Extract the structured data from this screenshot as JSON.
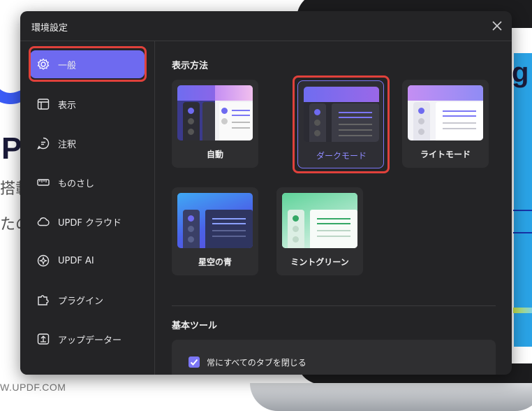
{
  "background": {
    "big_letter": "P",
    "text_line1": "搭載",
    "text_line2": "たの",
    "url": "W.UPDF.COM"
  },
  "dialog": {
    "title": "環境設定",
    "close_icon": "close-icon"
  },
  "sidebar": {
    "items": [
      {
        "label": "一般",
        "icon": "gear-icon",
        "active": true
      },
      {
        "label": "表示",
        "icon": "layout-icon",
        "active": false
      },
      {
        "label": "注釈",
        "icon": "comment-icon",
        "active": false
      },
      {
        "label": "ものさし",
        "icon": "ruler-icon",
        "active": false
      },
      {
        "label": "UPDF クラウド",
        "icon": "cloud-icon",
        "active": false
      },
      {
        "label": "UPDF AI",
        "icon": "ai-icon",
        "active": false
      },
      {
        "label": "プラグイン",
        "icon": "puzzle-icon",
        "active": false
      },
      {
        "label": "アップデーター",
        "icon": "update-icon",
        "active": false
      }
    ]
  },
  "main": {
    "display_section_title": "表示方法",
    "themes": [
      {
        "label": "自動",
        "selected": false
      },
      {
        "label": "ダークモード",
        "selected": true
      },
      {
        "label": "ライトモード",
        "selected": false
      },
      {
        "label": "星空の青",
        "selected": false
      },
      {
        "label": "ミントグリーン",
        "selected": false
      }
    ],
    "tools_section_title": "基本ツール",
    "close_all_tabs": {
      "label": "常にすべてのタブを閉じる",
      "checked": true
    }
  },
  "colors": {
    "accent": "#6e6af0",
    "highlight": "#e0413b",
    "dialog_bg": "#242426"
  }
}
